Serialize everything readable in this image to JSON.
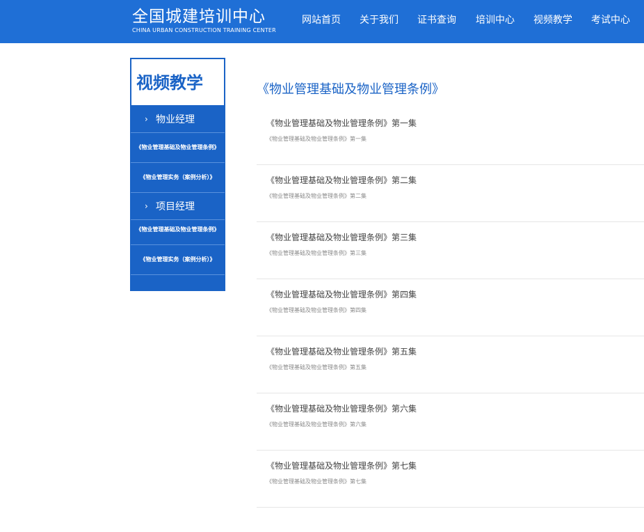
{
  "header": {
    "logo_title": "全国城建培训中心",
    "logo_subtitle": "CHINA URBAN CONSTRUCTION TRAINING CENTER",
    "nav": [
      "网站首页",
      "关于我们",
      "证书查询",
      "培训中心",
      "视频教学",
      "考试中心"
    ]
  },
  "sidebar": {
    "title": "视频教学",
    "categories": [
      {
        "label": "物业经理",
        "items": [
          "《物业管理基础及物业管理条例》",
          "《物业管理实务（案例分析）》"
        ]
      },
      {
        "label": "项目经理",
        "items": [
          "《物业管理基础及物业管理条例》",
          "《物业管理实务（案例分析）》"
        ]
      }
    ]
  },
  "main": {
    "title": "《物业管理基础及物业管理条例》",
    "items": [
      {
        "title": "《物业管理基础及物业管理条例》第一集",
        "subtitle": "《物业管理基础及物业管理条例》第一集"
      },
      {
        "title": "《物业管理基础及物业管理条例》第二集",
        "subtitle": "《物业管理基础及物业管理条例》第二集"
      },
      {
        "title": "《物业管理基础及物业管理条例》第三集",
        "subtitle": "《物业管理基础及物业管理条例》第三集"
      },
      {
        "title": "《物业管理基础及物业管理条例》第四集",
        "subtitle": "《物业管理基础及物业管理条例》第四集"
      },
      {
        "title": "《物业管理基础及物业管理条例》第五集",
        "subtitle": "《物业管理基础及物业管理条例》第五集"
      },
      {
        "title": "《物业管理基础及物业管理条例》第六集",
        "subtitle": "《物业管理基础及物业管理条例》第六集"
      },
      {
        "title": "《物业管理基础及物业管理条例》第七集",
        "subtitle": "《物业管理基础及物业管理条例》第七集"
      }
    ]
  },
  "colors": {
    "brand": "#1f6fd6",
    "sidebar": "#1a63c6",
    "divider": "#e6e6e6"
  }
}
